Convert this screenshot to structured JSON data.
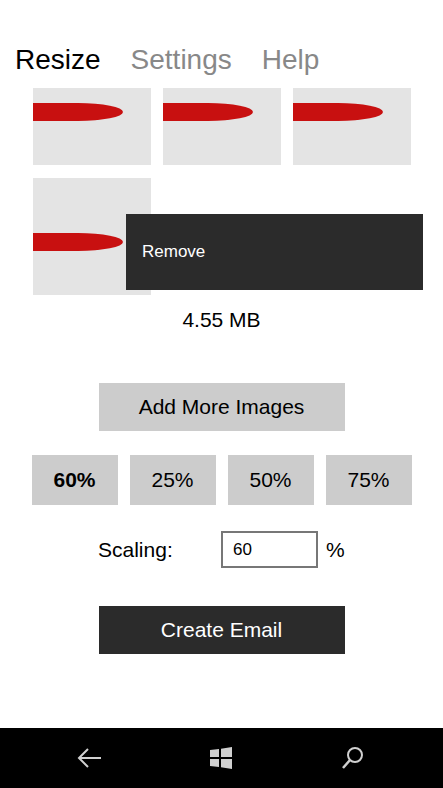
{
  "pivot": [
    {
      "label": "Resize",
      "selected": true
    },
    {
      "label": "Settings",
      "selected": false
    },
    {
      "label": "Help",
      "selected": false
    }
  ],
  "thumbnails": [
    {
      "has_menu": false
    },
    {
      "has_menu": false
    },
    {
      "has_menu": false
    },
    {
      "has_menu": true
    }
  ],
  "context_menu": {
    "items": [
      "Remove"
    ]
  },
  "total_size": "4.55 MB",
  "add_button": "Add More Images",
  "presets": [
    {
      "label": "60%",
      "selected": true
    },
    {
      "label": "25%",
      "selected": false
    },
    {
      "label": "50%",
      "selected": false
    },
    {
      "label": "75%",
      "selected": false
    }
  ],
  "scaling": {
    "label": "Scaling:",
    "value": "60",
    "unit": "%"
  },
  "create_button": "Create Email"
}
